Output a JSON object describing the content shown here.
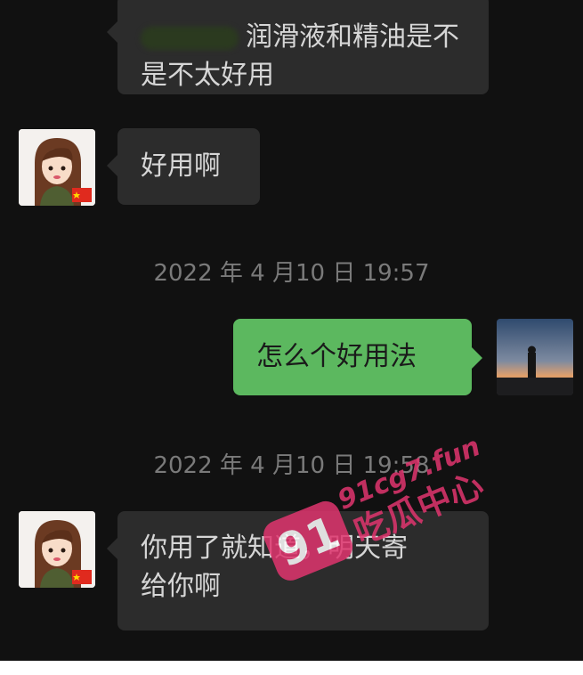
{
  "messages": {
    "m1": {
      "sender": "contact",
      "text_line1": "润滑液和精油是不",
      "text_line2": "是不太好用"
    },
    "m2": {
      "sender": "contact",
      "text": "好用啊"
    },
    "ts1": "2022 年 4 月10 日 19:57",
    "m3": {
      "sender": "self",
      "text": "怎么个好用法"
    },
    "ts2": "2022 年 4 月10 日 19:58",
    "m4": {
      "sender": "contact",
      "text_line1": "你用了就知道，明天寄",
      "text_line2": "给你啊"
    }
  },
  "watermark": {
    "badge_text": "91",
    "site_text": "91cg7.fun",
    "name_text": "吃瓜中心",
    "color": "#e0356e"
  },
  "colors": {
    "background": "#111111",
    "incoming_bubble": "#2c2c2c",
    "outgoing_bubble": "#5cb85f"
  }
}
